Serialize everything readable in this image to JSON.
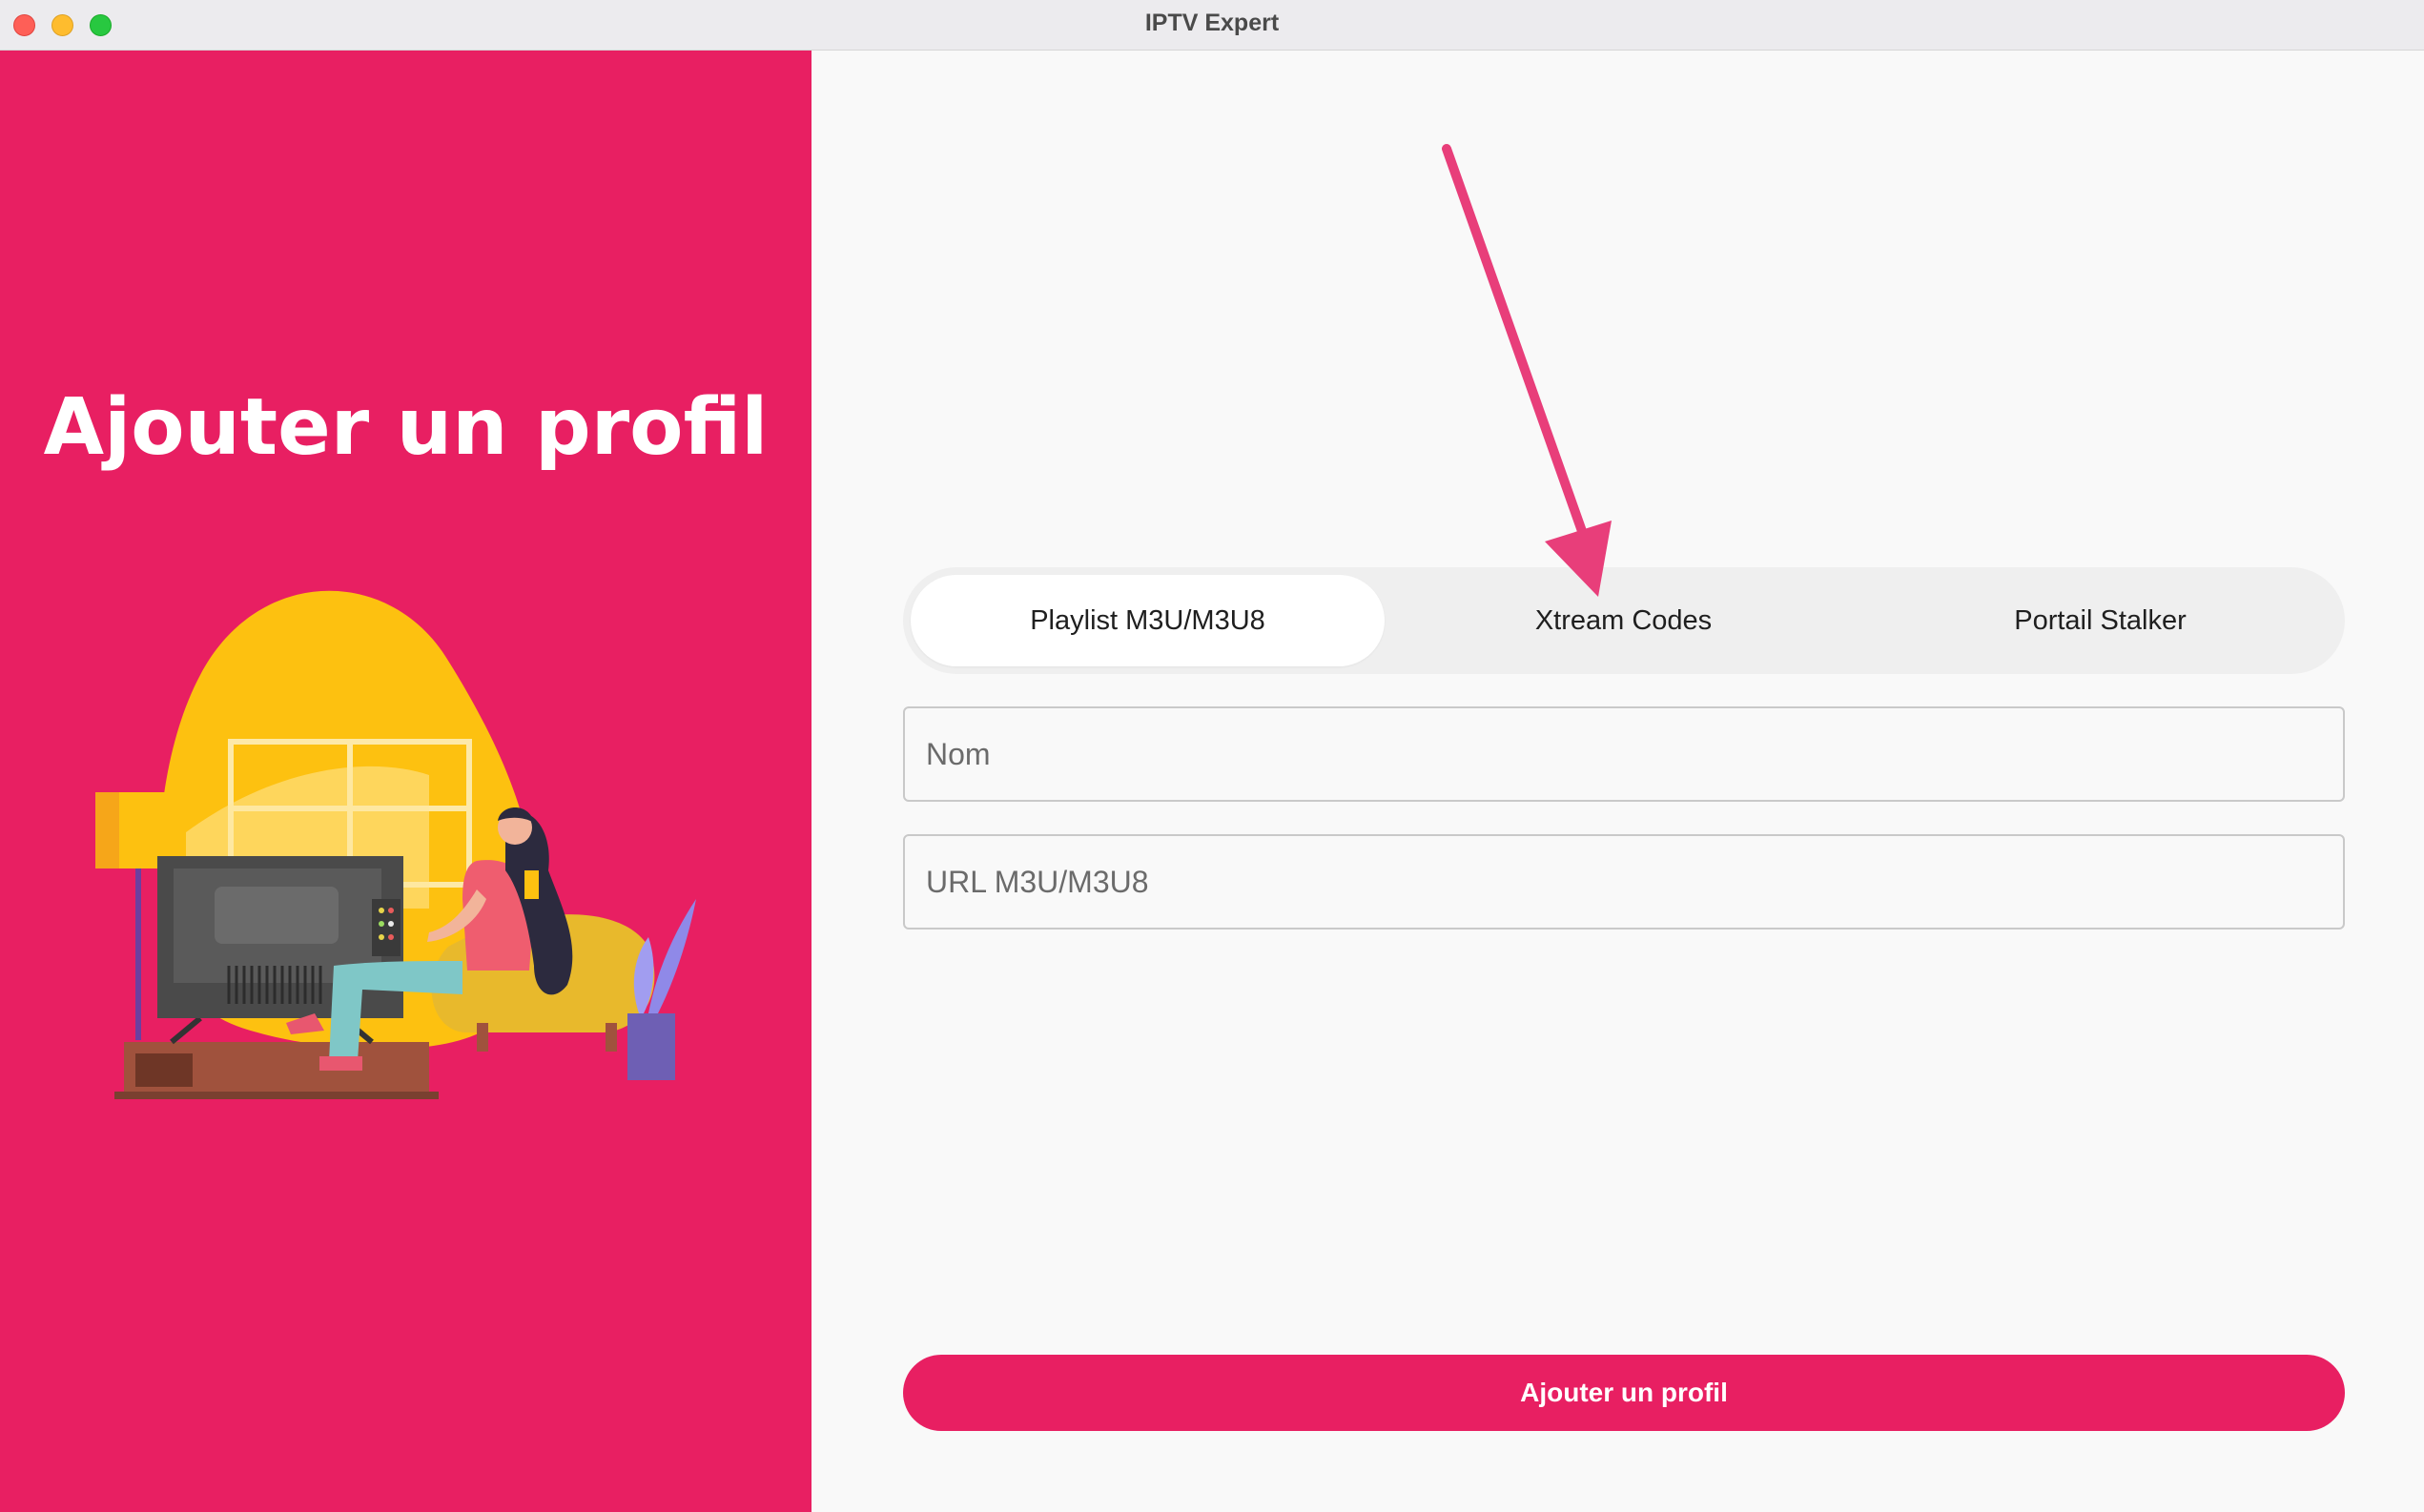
{
  "window": {
    "title": "IPTV Expert",
    "controls": [
      "close",
      "minimize",
      "maximize"
    ]
  },
  "left_panel": {
    "heading": "Ajouter un profil",
    "illustration": "person-watching-tv-illustration",
    "background_color": "#e81f62"
  },
  "tabs": {
    "items": [
      {
        "label": "Playlist M3U/M3U8",
        "active": true
      },
      {
        "label": "Xtream Codes",
        "active": false
      },
      {
        "label": "Portail Stalker",
        "active": false
      }
    ]
  },
  "form": {
    "name_placeholder": "Nom",
    "url_placeholder": "URL M3U/M3U8",
    "submit_label": "Ajouter un profil"
  },
  "annotation": {
    "type": "arrow",
    "points_to": "Xtream Codes",
    "color": "#e83e7a"
  },
  "colors": {
    "accent": "#e81f62",
    "tab_track": "#efefef",
    "tab_active": "#ffffff"
  }
}
